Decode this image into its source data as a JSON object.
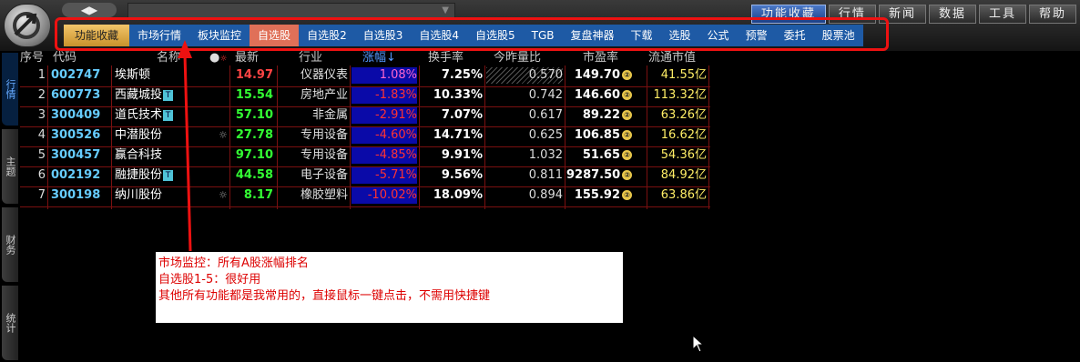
{
  "title_bar": {
    "nav_arrows": "◀▶",
    "right_buttons": [
      {
        "label": "功能收藏",
        "active": true
      },
      {
        "label": "行情",
        "active": false
      },
      {
        "label": "新闻",
        "active": false
      },
      {
        "label": "数据",
        "active": false
      },
      {
        "label": "工具",
        "active": false
      },
      {
        "label": "帮助",
        "active": false
      }
    ]
  },
  "toolbar": {
    "items": [
      "功能收藏",
      "市场行情",
      "板块监控",
      "自选股",
      "自选股2",
      "自选股3",
      "自选股4",
      "自选股5",
      "TGB",
      "复盘神器",
      "下载",
      "选股",
      "公式",
      "预警",
      "委托",
      "股票池"
    ],
    "selected": "自选股"
  },
  "side_tabs": [
    "行情",
    "主题",
    "财务",
    "统计"
  ],
  "table": {
    "headers": {
      "seq": "序号",
      "code": "代码",
      "name": "名称",
      "price": "最新",
      "industry": "行业",
      "change": "涨幅↓",
      "turnover": "换手率",
      "vol_ratio": "今昨量比",
      "pe": "市盈率",
      "float_cap": "流通市值"
    },
    "rows": [
      {
        "seq": "1",
        "code": "002747",
        "name": "埃斯顿",
        "badge": "",
        "star": "",
        "price": "14.97",
        "industry": "仪器仪表",
        "change": "1.08%",
        "turnover": "7.25%",
        "vol_ratio": "0.570",
        "pe": "149.70",
        "pe_mark": "②",
        "float_cap": "41.55亿"
      },
      {
        "seq": "2",
        "code": "600773",
        "name": "西藏城投",
        "badge": "T",
        "star": "",
        "price": "15.54",
        "industry": "房地产业",
        "change": "-1.83%",
        "turnover": "10.33%",
        "vol_ratio": "0.742",
        "pe": "146.60",
        "pe_mark": "②",
        "float_cap": "113.32亿"
      },
      {
        "seq": "3",
        "code": "300409",
        "name": "道氏技术",
        "badge": "T",
        "star": "",
        "price": "57.10",
        "industry": "非金属",
        "change": "-2.91%",
        "turnover": "7.07%",
        "vol_ratio": "0.617",
        "pe": "89.22",
        "pe_mark": "②",
        "float_cap": "63.26亿"
      },
      {
        "seq": "4",
        "code": "300526",
        "name": "中潜股份",
        "badge": "",
        "star": "☼",
        "price": "27.78",
        "industry": "专用设备",
        "change": "-4.60%",
        "turnover": "14.71%",
        "vol_ratio": "0.625",
        "pe": "106.85",
        "pe_mark": "②",
        "float_cap": "16.62亿"
      },
      {
        "seq": "5",
        "code": "300457",
        "name": "赢合科技",
        "badge": "",
        "star": "",
        "price": "97.10",
        "industry": "专用设备",
        "change": "-4.85%",
        "turnover": "9.91%",
        "vol_ratio": "1.032",
        "pe": "51.65",
        "pe_mark": "②",
        "float_cap": "54.36亿"
      },
      {
        "seq": "6",
        "code": "002192",
        "name": "融捷股份",
        "badge": "T",
        "star": "",
        "price": "44.58",
        "industry": "电子设备",
        "change": "-5.71%",
        "turnover": "9.56%",
        "vol_ratio": "0.811",
        "pe": "9287.50",
        "pe_mark": "②",
        "float_cap": "84.92亿"
      },
      {
        "seq": "7",
        "code": "300198",
        "name": "纳川股份",
        "badge": "",
        "star": "☼",
        "price": "8.17",
        "industry": "橡胶塑料",
        "change": "-10.02%",
        "turnover": "18.09%",
        "vol_ratio": "0.894",
        "pe": "155.92",
        "pe_mark": "②",
        "float_cap": "63.86亿"
      }
    ]
  },
  "annotation": {
    "lines": [
      "市场监控：所有A股涨幅排名",
      "自选股1-5：很好用",
      "其他所有功能都是我常用的，直接鼠标一键点击，不需用快捷键"
    ]
  },
  "colors": {
    "highlight": "#ee1111",
    "toolbar": "#1e5aa5",
    "up": "#ff3333",
    "down_green": "#33ff33",
    "code": "#66ccff",
    "cap": "#ffee66"
  }
}
